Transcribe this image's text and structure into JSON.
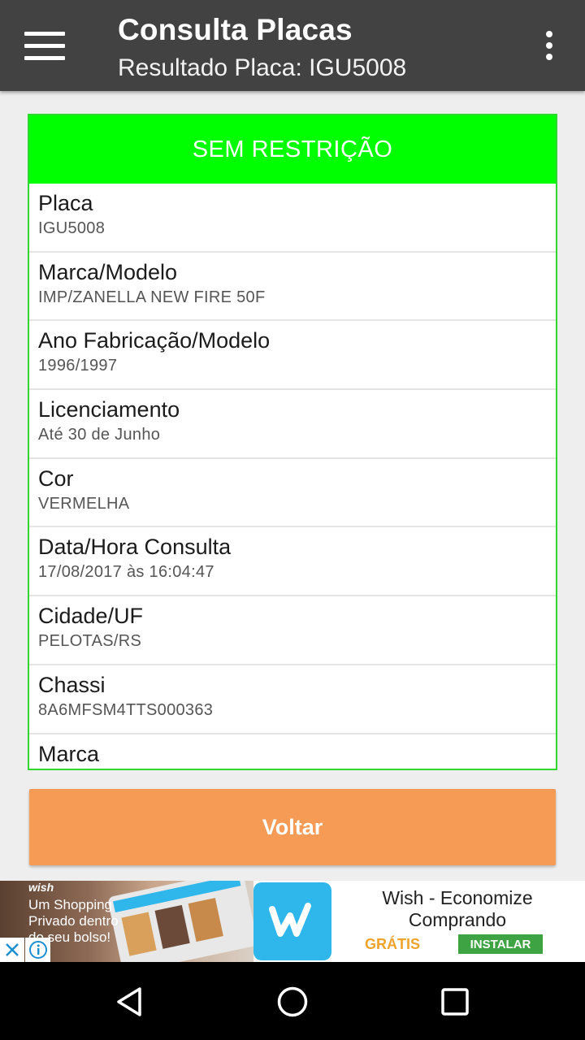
{
  "appbar": {
    "title": "Consulta Placas",
    "subtitle": "Resultado Placa: IGU5008",
    "menu_icon": "menu-icon",
    "overflow_icon": "more-vert-icon"
  },
  "result": {
    "status": "SEM RESTRIÇÃO",
    "status_color": "#00ff00",
    "fields": [
      {
        "label": "Placa",
        "value": "IGU5008"
      },
      {
        "label": "Marca/Modelo",
        "value": "IMP/ZANELLA NEW FIRE 50F"
      },
      {
        "label": "Ano Fabricação/Modelo",
        "value": "1996/1997"
      },
      {
        "label": "Licenciamento",
        "value": "Até 30 de Junho"
      },
      {
        "label": "Cor",
        "value": "VERMELHA"
      },
      {
        "label": "Data/Hora Consulta",
        "value": "17/08/2017 às 16:04:47"
      },
      {
        "label": "Cidade/UF",
        "value": "PELOTAS/RS"
      },
      {
        "label": "Chassi",
        "value": "8A6MFSM4TTS000363"
      },
      {
        "label": "Marca",
        "value": ""
      }
    ]
  },
  "actions": {
    "back_label": "Voltar",
    "back_color": "#f59b56"
  },
  "ad": {
    "brand": "wish",
    "tagline": "Um Shopping Privado dentro do seu bolso!",
    "title": "Wish - Economize Comprando",
    "price": "GRÁTIS",
    "install_label": "INSTALAR",
    "close_icon": "close-icon",
    "info_icon": "info-icon"
  },
  "navbar": {
    "back_icon": "nav-back-icon",
    "home_icon": "nav-home-icon",
    "recents_icon": "nav-recents-icon"
  }
}
